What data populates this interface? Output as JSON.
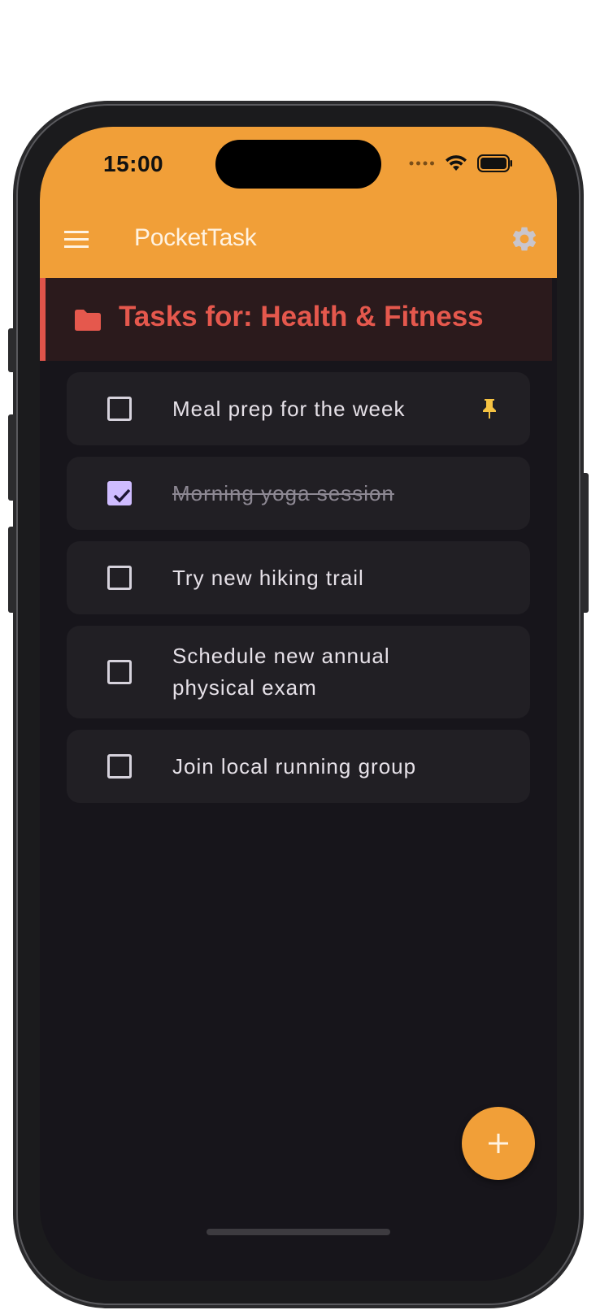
{
  "status_bar": {
    "time": "15:00",
    "icons": [
      "signal-dots-icon",
      "wifi-icon",
      "battery-icon"
    ]
  },
  "app_bar": {
    "title": "PocketTask",
    "menu_icon": "hamburger-menu-icon",
    "settings_icon": "gear-icon"
  },
  "category": {
    "icon": "folder-icon",
    "title": "Tasks for: Health & Fitness",
    "color": "#e5584d"
  },
  "tasks": [
    {
      "text": "Meal prep for the week",
      "done": false,
      "pinned": true
    },
    {
      "text": "Morning yoga session",
      "done": true,
      "pinned": false
    },
    {
      "text": "Try new hiking trail",
      "done": false,
      "pinned": false
    },
    {
      "text": "Schedule new annual physical exam",
      "done": false,
      "pinned": false
    },
    {
      "text": "Join local running group",
      "done": false,
      "pinned": false
    }
  ],
  "fab": {
    "icon": "plus-icon"
  },
  "colors": {
    "accent": "#f19f38",
    "background": "#17151b",
    "card": "#211f24",
    "checkbox_checked": "#cfbcff",
    "pin": "#f5c242"
  }
}
